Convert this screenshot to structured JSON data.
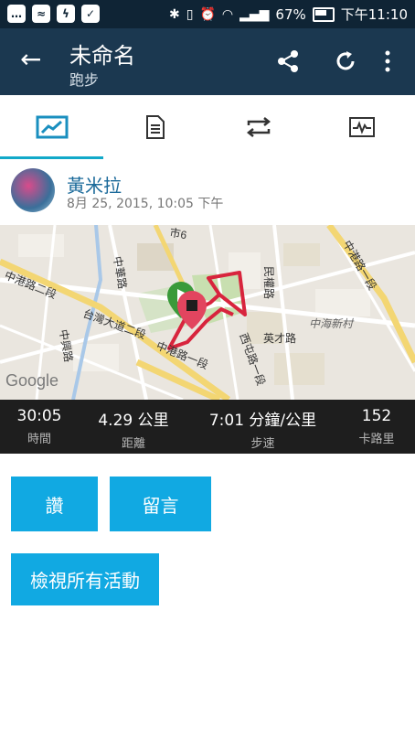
{
  "status_bar": {
    "battery": "67%",
    "time": "下午11:10"
  },
  "app_bar": {
    "title": "未命名",
    "subtitle": "跑步"
  },
  "tabs": [
    "overview-tab",
    "details-tab",
    "laps-tab",
    "charts-tab"
  ],
  "activity": {
    "owner_name": "黃米拉",
    "datetime": "8月 25, 2015, 10:05 下午"
  },
  "map": {
    "labels": {
      "zhonggang_2": "中港路二段",
      "taiwan_blvd_2": "台灣大道二段",
      "zhonggang_1_bottom": "中港路一段",
      "zhonggang_1_right": "中港路一段",
      "city6": "市6",
      "bei_road": "民權路",
      "zhonghai": "中海新村",
      "yingcai": "英才路",
      "xitun": "西屯路一段",
      "left_road1": "中華路",
      "left_road2": "中興路",
      "google": "Google"
    }
  },
  "stats": [
    {
      "value": "30:05",
      "label": "時間"
    },
    {
      "value": "4.29 公里",
      "label": "距離"
    },
    {
      "value": "7:01 分鐘/公里",
      "label": "步速"
    },
    {
      "value": "152",
      "label": "卡路里"
    }
  ],
  "actions": {
    "like": "讚",
    "comment": "留言",
    "view_all": "檢視所有活動"
  }
}
